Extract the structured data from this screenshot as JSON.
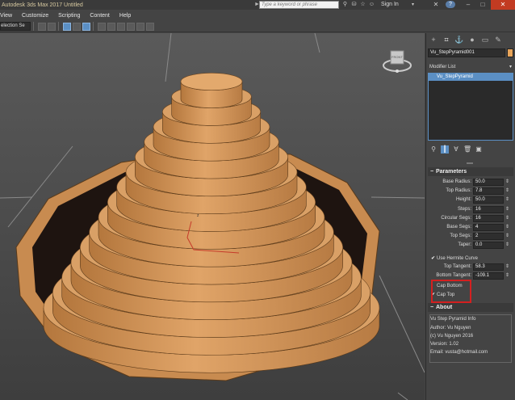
{
  "titlebar": {
    "title": "Autodesk 3ds Max 2017    Untitled",
    "search_placeholder": "Type a keyword or phrase",
    "sign_in": "Sign In",
    "help": "?"
  },
  "menu": [
    "View",
    "Customize",
    "Scripting",
    "Content",
    "Help"
  ],
  "toolbar": {
    "selection_set": "election Se"
  },
  "viewport": {
    "viewcube_label": "FRONT",
    "gizmo_label": "z",
    "object_color": "#d9a066"
  },
  "panel": {
    "object_name": "Vu_StepPyramid001",
    "object_color": "#e8a55a",
    "modifier_list_label": "Modifier List",
    "modifier_stack": [
      "Vu_StepPyramid"
    ],
    "parameters": {
      "title": "Parameters",
      "fields": [
        {
          "label": "Base Radius:",
          "value": "50.0"
        },
        {
          "label": "Top Radius:",
          "value": "7.8"
        },
        {
          "label": "Height:",
          "value": "50.0"
        },
        {
          "label": "Steps:",
          "value": "16"
        },
        {
          "label": "Circular Segs:",
          "value": "16"
        },
        {
          "label": "Base Segs:",
          "value": "4"
        },
        {
          "label": "Top Segs:",
          "value": "2"
        },
        {
          "label": "Taper:",
          "value": "0.0"
        }
      ],
      "use_hermite": {
        "label": "Use Hermite Curve",
        "checked": true
      },
      "tangents": [
        {
          "label": "Top Tangent:",
          "value": "58.3"
        },
        {
          "label": "Bottom Tangent:",
          "value": "-109.1"
        }
      ],
      "cap_bottom": {
        "label": "Cap Bottom",
        "checked": false
      },
      "cap_top": {
        "label": "Cap Top",
        "checked": true
      }
    },
    "about": {
      "title": "About",
      "lines": [
        "Vu Step Pyramid Info",
        "Author: Vu Nguyen",
        "(c) Vu Nguyen 2016",
        "Version: 1.02",
        "Email: vusta@hotmail.com"
      ]
    }
  }
}
